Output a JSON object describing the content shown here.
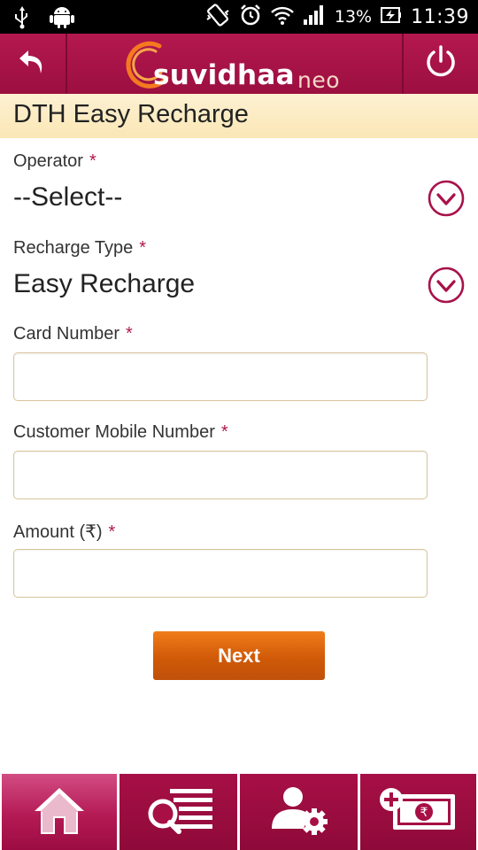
{
  "status_bar": {
    "battery_percent": "13%",
    "time": "11:39",
    "icons": [
      "usb-icon",
      "android-icon",
      "vibrate-icon",
      "alarm-icon",
      "wifi-icon",
      "signal-icon",
      "battery-icon"
    ]
  },
  "header": {
    "logo_main": "suvidhaa",
    "logo_neo": "neo",
    "back_icon": "back-arrow-icon",
    "power_icon": "power-icon"
  },
  "page": {
    "title": "DTH Easy Recharge"
  },
  "form": {
    "required_mark": "*",
    "operator": {
      "label": "Operator",
      "value": "--Select--"
    },
    "recharge_type": {
      "label": "Recharge Type",
      "value": "Easy Recharge"
    },
    "card_number": {
      "label": "Card Number",
      "value": ""
    },
    "customer_mobile": {
      "label": "Customer Mobile Number",
      "value": ""
    },
    "amount": {
      "label": "Amount (₹)",
      "value": ""
    },
    "next_label": "Next"
  },
  "bottom_nav": {
    "items": [
      {
        "icon": "home-icon",
        "active": true
      },
      {
        "icon": "search-list-icon",
        "active": false
      },
      {
        "icon": "user-settings-icon",
        "active": false
      },
      {
        "icon": "add-money-icon",
        "active": false
      }
    ]
  },
  "colors": {
    "brand": "#a8124a",
    "title_strip": "#fdefc8",
    "required": "#b01a4a",
    "button": "#d8620c"
  }
}
